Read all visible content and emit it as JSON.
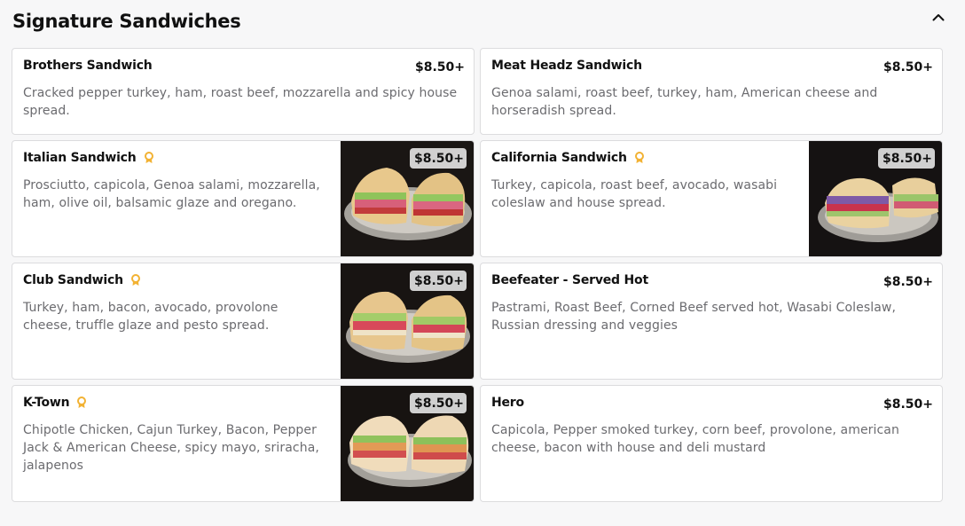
{
  "section": {
    "title": "Signature Sandwiches",
    "collapse_icon": "chevron-up-icon"
  },
  "colors": {
    "badge": "#f2b233",
    "card_border": "#dcdcde",
    "description": "#6b6b6f",
    "price_pill": "#e1e1e1"
  },
  "items": [
    {
      "name": "Brothers Sandwich",
      "price": "$8.50+",
      "description": "Cracked pepper turkey, ham, roast beef, mozzarella and spicy house spread.",
      "badge": false,
      "photo": false
    },
    {
      "name": "Meat Headz Sandwich",
      "price": "$8.50+",
      "description": "Genoa salami, roast beef, turkey, ham, American cheese and horseradish spread.",
      "badge": false,
      "photo": false
    },
    {
      "name": "Italian Sandwich",
      "price": "$8.50+",
      "description": "Prosciutto, capicola, Genoa salami, mozzarella, ham, olive oil, balsamic glaze and oregano.",
      "badge": true,
      "photo": true
    },
    {
      "name": "California Sandwich",
      "price": "$8.50+",
      "description": "Turkey, capicola, roast beef, avocado, wasabi coleslaw and house spread.",
      "badge": true,
      "photo": true
    },
    {
      "name": "Club Sandwich",
      "price": "$8.50+",
      "description": "Turkey, ham, bacon, avocado, provolone cheese, truffle glaze and pesto spread.",
      "badge": true,
      "photo": true
    },
    {
      "name": "Beefeater - Served Hot",
      "price": "$8.50+",
      "description": "Pastrami, Roast Beef, Corned Beef served hot, Wasabi Coleslaw, Russian dressing and veggies",
      "badge": false,
      "photo": false
    },
    {
      "name": "K-Town",
      "price": "$8.50+",
      "description": "Chipotle Chicken, Cajun Turkey, Bacon, Pepper Jack & American Cheese, spicy mayo, sriracha, jalapenos",
      "badge": true,
      "photo": true
    },
    {
      "name": "Hero",
      "price": "$8.50+",
      "description": "Capicola, Pepper smoked turkey, corn beef, provolone, american cheese, bacon with house and deli mustard",
      "badge": false,
      "photo": false
    }
  ]
}
